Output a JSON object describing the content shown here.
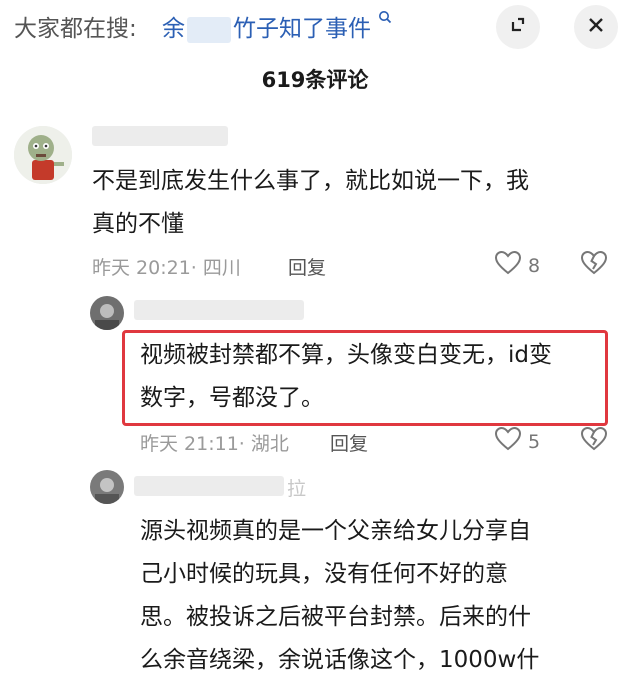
{
  "search": {
    "prefix": "大家都在搜:",
    "query_start": "余",
    "query_end": "竹子知了事件"
  },
  "header": {
    "title": "619条评论"
  },
  "comments": [
    {
      "text_line1": "不是到底发生什么事了，就比如说一下，我",
      "text_line2": "真的不懂",
      "meta": "昨天 20:21· 四川",
      "reply_label": "回复",
      "likes": "8",
      "replies": [
        {
          "text_line1": "视频被封禁都不算，头像变白变无，id变",
          "text_line2": "数字，号都没了。",
          "meta": "昨天 21:11· 湖北",
          "reply_label": "回复",
          "likes": "5"
        },
        {
          "name_trail": "拉",
          "text_line1": "源头视频真的是一个父亲给女儿分享自",
          "text_line2": "己小时候的玩具，没有任何不好的意",
          "text_line3": "思。被投诉之后被平台封禁。后来的什",
          "text_line4": "么余音绕梁，余说话像这个，1000w什"
        }
      ]
    }
  ],
  "colors": {
    "highlight": "#e0383f",
    "query": "#2b5fb4"
  }
}
